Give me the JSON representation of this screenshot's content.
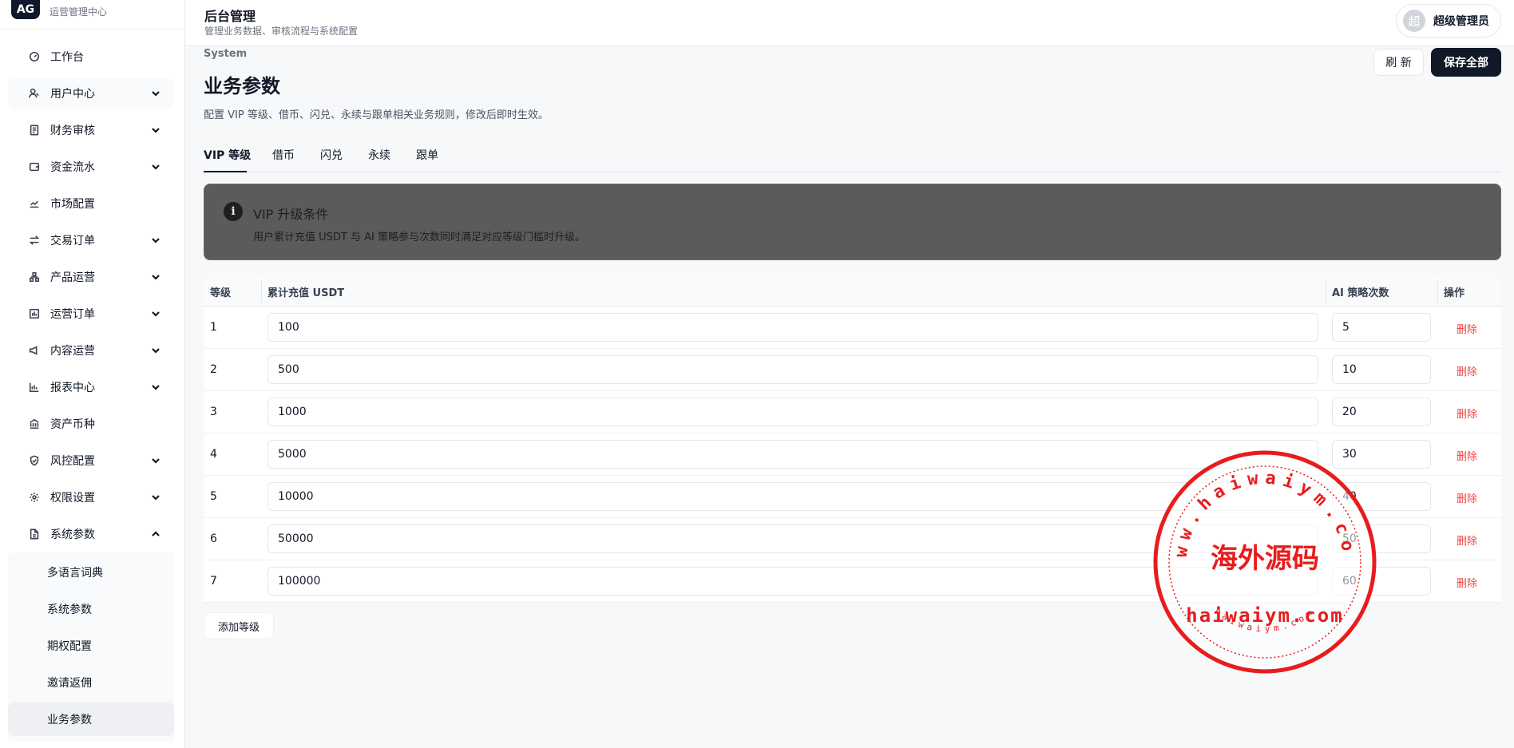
{
  "sidebar": {
    "logo": "AG",
    "subtitle": "运营管理中心",
    "items": [
      {
        "label": "工作台"
      },
      {
        "label": "用户中心"
      },
      {
        "label": "财务审核"
      },
      {
        "label": "资金流水"
      },
      {
        "label": "市场配置"
      },
      {
        "label": "交易订单"
      },
      {
        "label": "产品运营"
      },
      {
        "label": "运营订单"
      },
      {
        "label": "内容运营"
      },
      {
        "label": "报表中心"
      },
      {
        "label": "资产币种"
      },
      {
        "label": "风控配置"
      },
      {
        "label": "权限设置"
      },
      {
        "label": "系统参数"
      }
    ],
    "sub_items": [
      {
        "label": "多语言词典"
      },
      {
        "label": "系统参数"
      },
      {
        "label": "期权配置"
      },
      {
        "label": "邀请返佣"
      },
      {
        "label": "业务参数"
      }
    ]
  },
  "header": {
    "title": "后台管理",
    "subtitle": "管理业务数据、审核流程与系统配置",
    "avatar_char": "超",
    "user_name": "超级管理员"
  },
  "page": {
    "eyebrow": "System",
    "title": "业务参数",
    "description": "配置 VIP 等级、借币、闪兑、永续与跟单相关业务规则，修改后即时生效。",
    "refresh_label": "刷 新",
    "save_label": "保存全部"
  },
  "tabs": [
    {
      "label": "VIP 等级",
      "active": true
    },
    {
      "label": "借币"
    },
    {
      "label": "闪兑"
    },
    {
      "label": "永续"
    },
    {
      "label": "跟单"
    }
  ],
  "banner": {
    "icon": "i",
    "title": "VIP 升级条件",
    "text": "用户累计充值 USDT 与 AI 策略参与次数同时满足对应等级门槛时升级。"
  },
  "table": {
    "headers": [
      "等级",
      "累计充值 USDT",
      "AI 策略次数",
      "操作"
    ],
    "rows": [
      {
        "level": "1",
        "usdt": "100",
        "ai": "5",
        "action": "删除"
      },
      {
        "level": "2",
        "usdt": "500",
        "ai": "10",
        "action": "删除"
      },
      {
        "level": "3",
        "usdt": "1000",
        "ai": "20",
        "action": "删除"
      },
      {
        "level": "4",
        "usdt": "5000",
        "ai": "30",
        "action": "删除"
      },
      {
        "level": "5",
        "usdt": "10000",
        "ai": "40",
        "action": "删除"
      },
      {
        "level": "6",
        "usdt": "50000",
        "ai": "50",
        "action": "删除"
      },
      {
        "level": "7",
        "usdt": "100000",
        "ai": "60",
        "action": "删除"
      }
    ],
    "add_label": "添加等级"
  },
  "watermark": {
    "arc_text": "www.haiwaiym.com",
    "center_text": "海外源码",
    "domain_text": "haiwaiym.com",
    "small_text": "haiwaiym.com",
    "color": "#e81c1c"
  }
}
